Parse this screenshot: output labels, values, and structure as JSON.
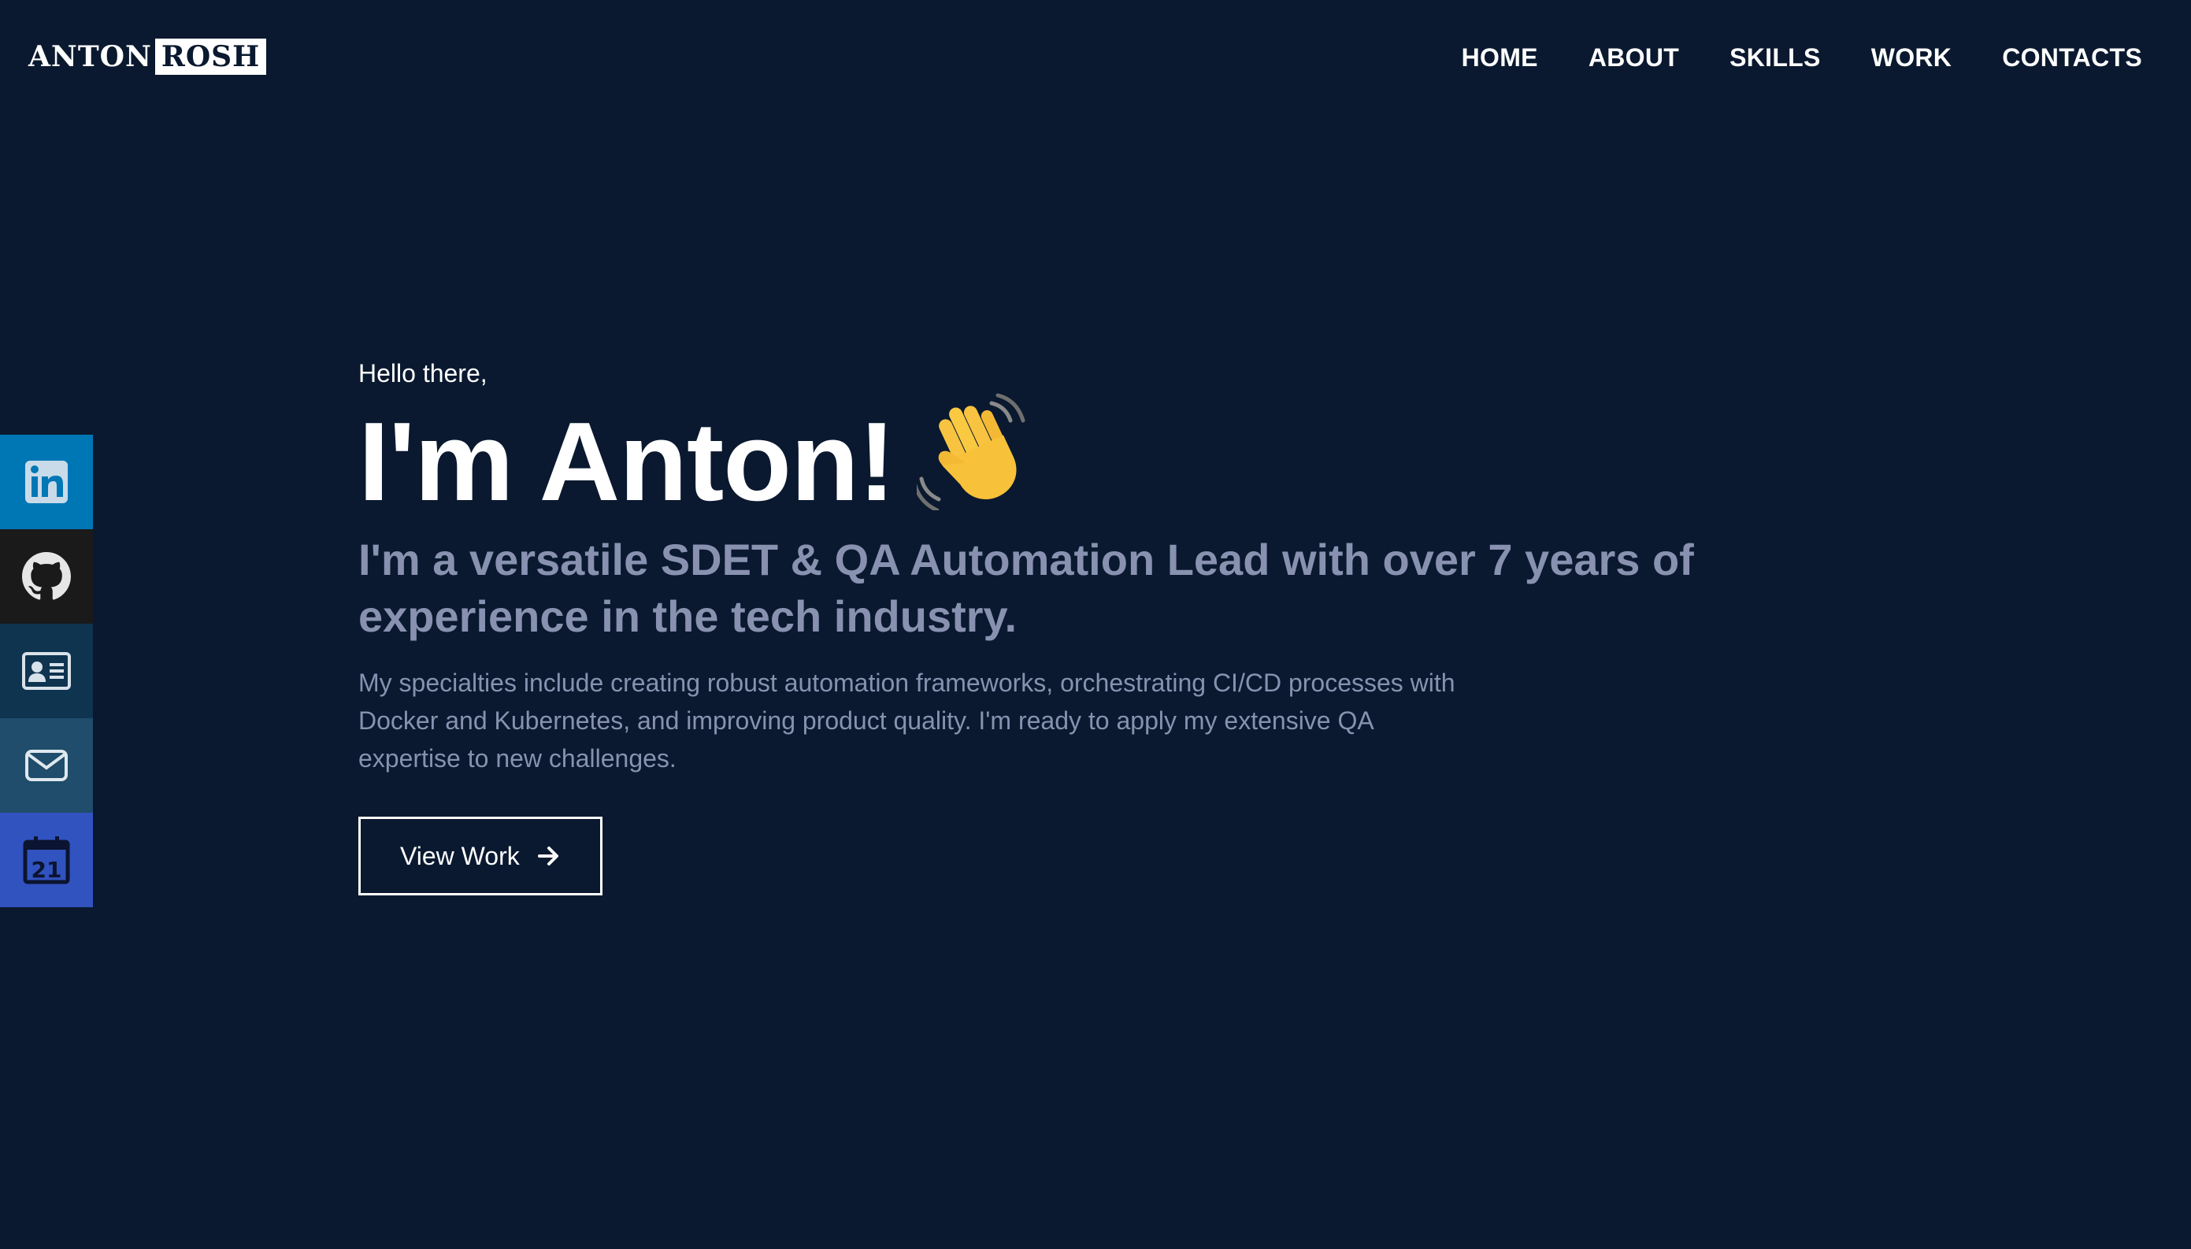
{
  "logo": {
    "first": "ANTON",
    "second": "ROSH"
  },
  "nav": {
    "items": [
      {
        "label": "HOME"
      },
      {
        "label": "ABOUT"
      },
      {
        "label": "SKILLS"
      },
      {
        "label": "WORK"
      },
      {
        "label": "CONTACTS"
      }
    ]
  },
  "social": {
    "items": [
      {
        "icon": "linkedin-icon",
        "color": "#0077b5"
      },
      {
        "icon": "github-icon",
        "color": "#1b1a1a"
      },
      {
        "icon": "contact-card-icon",
        "color": "#0e3450"
      },
      {
        "icon": "mail-icon",
        "color": "#1f4d6b"
      },
      {
        "icon": "calendar-icon",
        "color": "#3153c0",
        "text": "21"
      }
    ]
  },
  "hero": {
    "greeting": "Hello there,",
    "title": "I'm Anton!",
    "wave_icon": "waving-hand-icon",
    "subtitle": "I'm a versatile SDET & QA Automation Lead with over 7 years of experience in the tech industry.",
    "description": "My specialties include creating robust automation frameworks, orchestrating CI/CD processes with Docker and Kubernetes, and improving product quality. I'm ready to apply my extensive QA expertise to new challenges.",
    "button_label": "View Work",
    "button_icon": "arrow-right-icon"
  },
  "colors": {
    "background": "#0a192f",
    "text_primary": "#ffffff",
    "text_secondary": "#8892b0"
  }
}
